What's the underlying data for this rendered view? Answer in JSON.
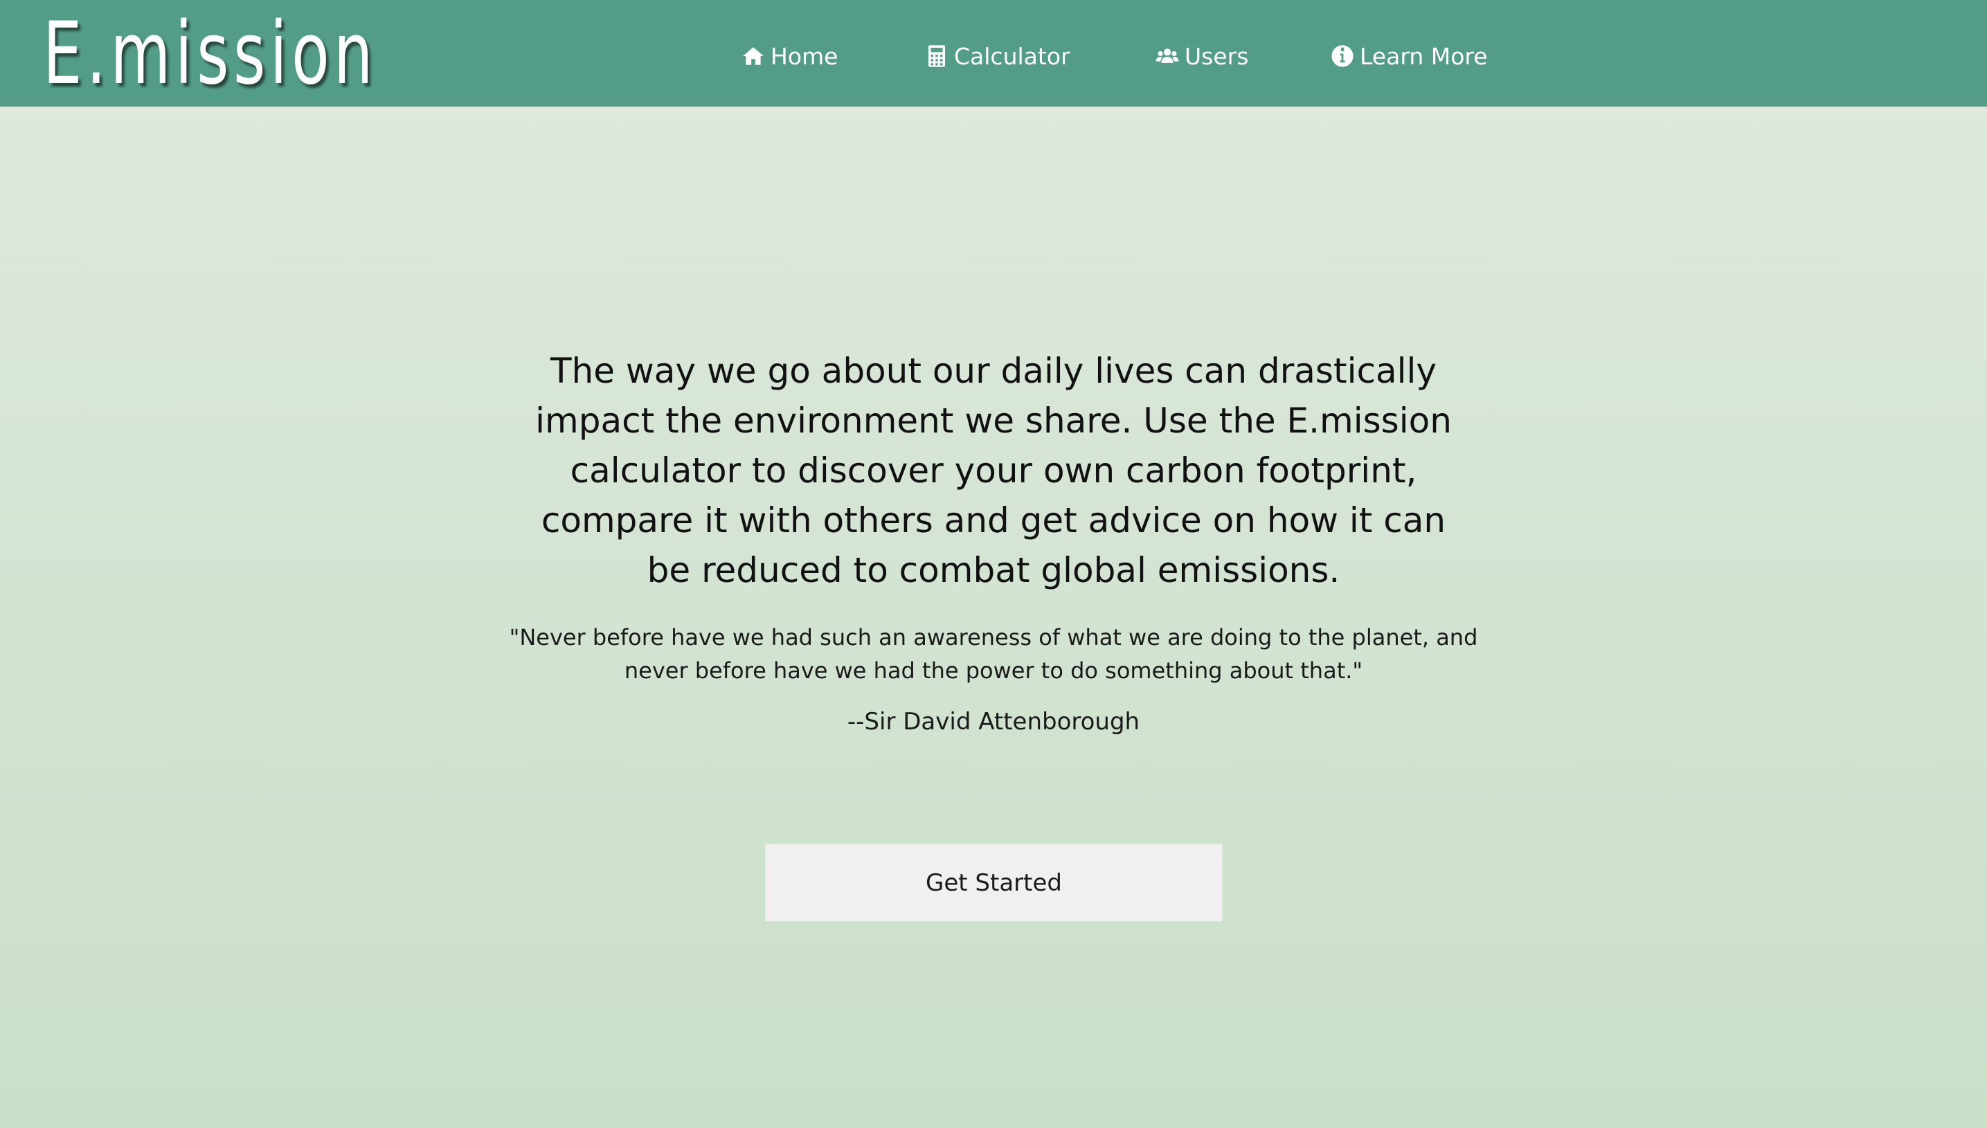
{
  "header": {
    "logo": "E.mission",
    "nav": [
      {
        "label": "Home",
        "icon": "home-icon"
      },
      {
        "label": "Calculator",
        "icon": "calculator-icon"
      },
      {
        "label": "Users",
        "icon": "users-icon"
      },
      {
        "label": "Learn More",
        "icon": "info-icon"
      }
    ]
  },
  "main": {
    "intro": "The way we go about our daily lives can drastically impact the environment we share. Use the E.mission calculator to discover your own carbon footprint, compare it with others and get advice on how it can be reduced to combat global emissions.",
    "quote": "\"Never before have we had such an awareness of what we are doing to the planet, and never before have we had the power to do something about that.\"",
    "author": "--Sir David Attenborough",
    "cta_label": "Get Started"
  },
  "colors": {
    "navbar": "#539d88",
    "background_top": "#e0e9df",
    "background_bottom": "#c9dfc8",
    "button": "#f0f0f0"
  }
}
